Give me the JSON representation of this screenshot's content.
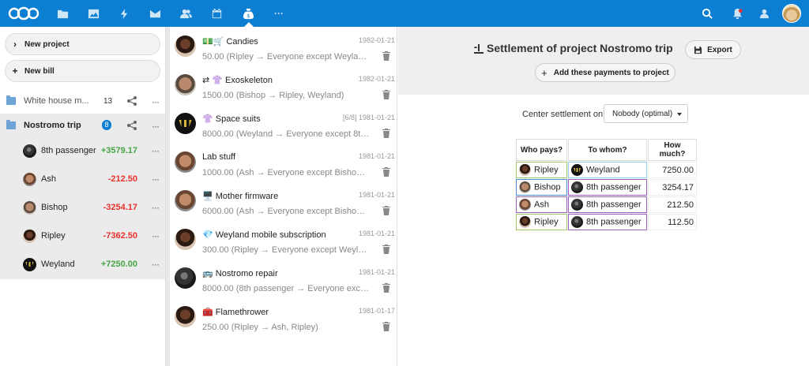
{
  "header": {
    "apps": [
      "files-icon",
      "photos-icon",
      "activity-icon",
      "mail-icon",
      "contacts-icon",
      "calendar-icon",
      "cospend-icon",
      "more-apps-icon"
    ],
    "right": [
      "search-icon",
      "notifications-icon",
      "contacts-menu-icon"
    ],
    "more": "···"
  },
  "nav": {
    "new_project": "New project",
    "new_bill": "New bill",
    "new_project_icon": "›",
    "new_bill_icon": "+",
    "projects": [
      {
        "name": "White house m...",
        "count": "13"
      },
      {
        "name": "Nostromo trip",
        "count": "8"
      }
    ],
    "members": [
      {
        "name": "8th passenger",
        "balance": "+3579.17"
      },
      {
        "name": "Ash",
        "balance": "-212.50"
      },
      {
        "name": "Bishop",
        "balance": "-3254.17"
      },
      {
        "name": "Ripley",
        "balance": "-7362.50"
      },
      {
        "name": "Weyland",
        "balance": "+7250.00"
      }
    ],
    "dots": "···"
  },
  "bills": [
    {
      "title": "💵🛒 Candies",
      "sub": "50.00 (Ripley → Everyone except Weyland)",
      "date": "1982-01-21"
    },
    {
      "title": "⇄ 👚 Exoskeleton",
      "sub": "1500.00 (Bishop → Ripley, Weyland)",
      "date": "1982-01-21"
    },
    {
      "title": "👚 Space suits",
      "sub": "8000.00 (Weyland → Everyone except 8th p...",
      "date": "[6/8] 1981-01-21"
    },
    {
      "title": "Lab stuff",
      "sub": "1000.00 (Ash → Everyone except Bishop an...",
      "date": "1981-01-21"
    },
    {
      "title": "🖥️ Mother firmware",
      "sub": "6000.00 (Ash → Everyone except Bishop an...",
      "date": "1981-01-21"
    },
    {
      "title": "💎 Weyland mobile subscription",
      "sub": "300.00 (Ripley → Everyone except Weyland)",
      "date": "1981-01-21"
    },
    {
      "title": "🚌 Nostromo repair",
      "sub": "8000.00 (8th passenger → Everyone except ...",
      "date": "1981-01-21"
    },
    {
      "title": "🧰 Flamethrower",
      "sub": "250.00 (Ripley → Ash, Ripley)",
      "date": "1981-01-17"
    }
  ],
  "main": {
    "title": "Settlement of project Nostromo trip",
    "export": "Export",
    "add_payments": "Add these payments to project",
    "center_label": "Center settlement on",
    "center_value": "Nobody (optimal)",
    "table": {
      "headers": [
        "Who pays?",
        "To whom?",
        "How much?"
      ],
      "rows": [
        {
          "from": "Ripley",
          "to": "Weyland",
          "amount": "7250.00"
        },
        {
          "from": "Bishop",
          "to": "8th passenger",
          "amount": "3254.17"
        },
        {
          "from": "Ash",
          "to": "8th passenger",
          "amount": "212.50"
        },
        {
          "from": "Ripley",
          "to": "8th passenger",
          "amount": "112.50"
        }
      ]
    }
  },
  "colors": {
    "header_bg": "#0d7fd3",
    "positive": "#46a546",
    "negative": "#e9322d",
    "ripley_border": "#a2c766",
    "bishop_border": "#4a8fd8",
    "ash_border": "#9b5fc0",
    "weyland_border": "#8fd0e6",
    "p8_border": "#9b5fc0"
  }
}
